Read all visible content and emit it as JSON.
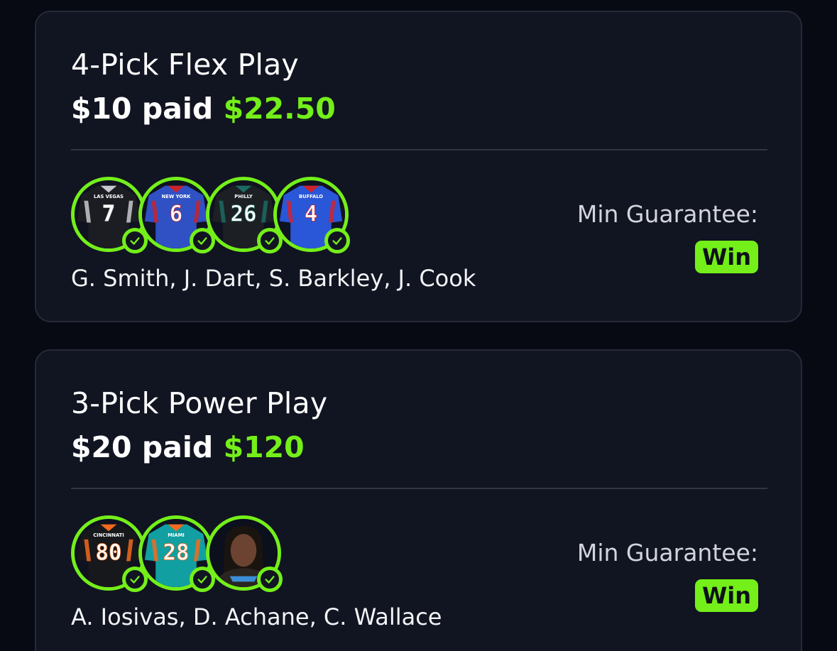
{
  "entries": [
    {
      "title": "4-Pick Flex Play",
      "paid": "$10 paid",
      "payout": "$22.50",
      "players_text": "G. Smith, J. Dart, S. Barkley, J. Cook",
      "guarantee_label": "Min Guarantee:",
      "result": "Win",
      "picks": [
        {
          "team": "LAS VEGAS",
          "number": "7",
          "jersey_color": "#1b1d22",
          "accent": "#c7c9cc",
          "status": "checked"
        },
        {
          "team": "NEW YORK",
          "number": "6",
          "jersey_color": "#2f51c4",
          "accent": "#c8232c",
          "status": "checked"
        },
        {
          "team": "PHILLY",
          "number": "26",
          "jersey_color": "#1c2024",
          "accent": "#1c6b63",
          "status": "checked"
        },
        {
          "team": "BUFFALO",
          "number": "4",
          "jersey_color": "#2a56d8",
          "accent": "#d1222c",
          "status": "checked"
        }
      ]
    },
    {
      "title": "3-Pick Power Play",
      "paid": "$20 paid",
      "payout": "$120",
      "players_text": "A. Iosivas, D. Achane, C. Wallace",
      "guarantee_label": "Min Guarantee:",
      "result": "Win",
      "picks": [
        {
          "team": "CINCINNATI",
          "number": "80",
          "jersey_color": "#17181b",
          "accent": "#f26a1d",
          "status": "checked"
        },
        {
          "team": "MIAMI",
          "number": "28",
          "jersey_color": "#119fa1",
          "accent": "#f26a1d",
          "status": "checked"
        },
        {
          "team": "",
          "number": "",
          "jersey_color": "#2a2520",
          "accent": "#3b8fd6",
          "status": "checked",
          "photo": "player-headshot"
        }
      ]
    }
  ],
  "colors": {
    "background": "#070913",
    "card": "#111421",
    "accent_green": "#74ef1a"
  }
}
